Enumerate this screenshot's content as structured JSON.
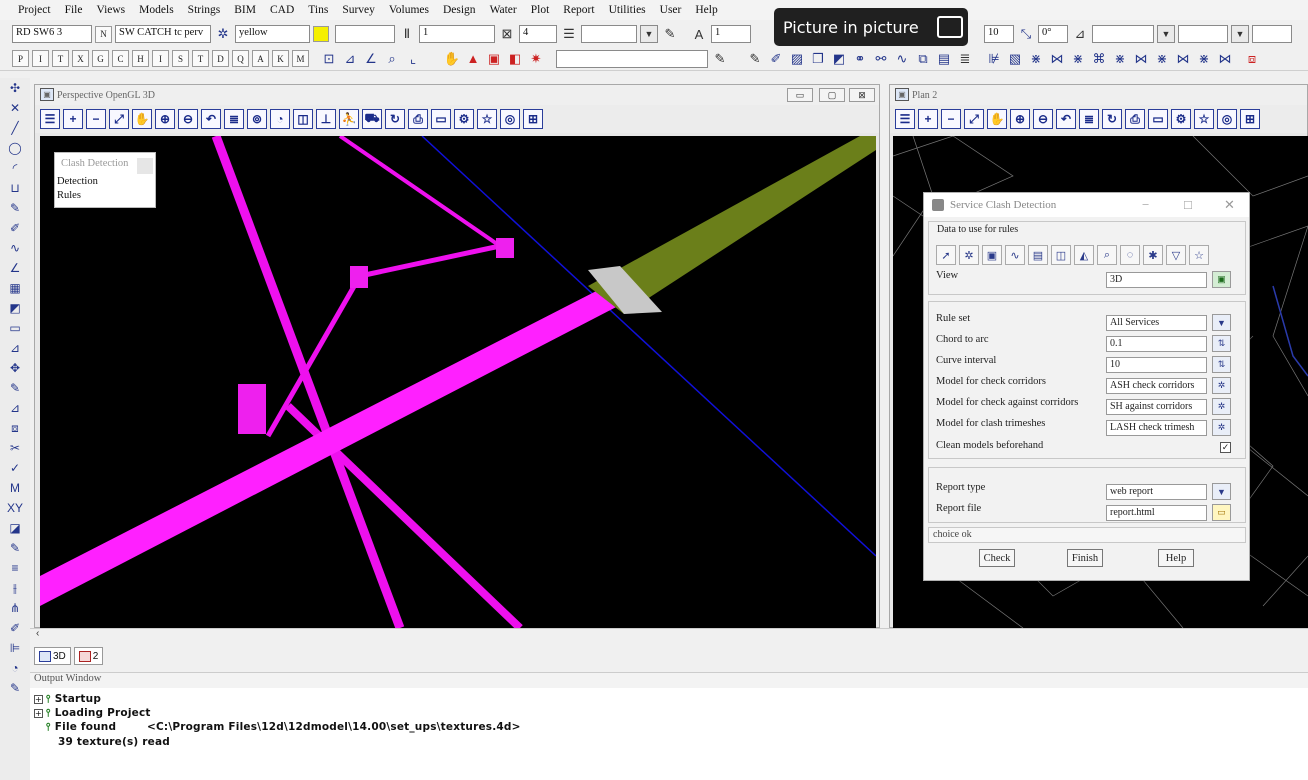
{
  "menu": [
    "Project",
    "File",
    "Views",
    "Models",
    "Strings",
    "BIM",
    "CAD",
    "Tins",
    "Survey",
    "Volumes",
    "Design",
    "Water",
    "Plot",
    "Report",
    "Utilities",
    "User",
    "Help"
  ],
  "toolbar1": {
    "string_field": "RD SW6 3",
    "n_button": "N",
    "name_field": "SW CATCH tc perv",
    "colour_field": "yellow",
    "colour_swatch": "#f5f000",
    "weight_field": "1",
    "style_field": "4",
    "height_field": "1",
    "size_field": "10",
    "angle_field": "0°"
  },
  "toolbar2": {
    "letters": [
      "P",
      "I",
      "T",
      "X",
      "G",
      "C",
      "H",
      "I",
      "S",
      "T",
      "D",
      "Q",
      "A",
      "K",
      "M"
    ]
  },
  "pip": {
    "label": "Picture in picture"
  },
  "left_window": {
    "title": "Perspective OpenGL 3D",
    "clash_panel": {
      "title": "Clash Detection",
      "items": [
        "Detection",
        "Rules"
      ]
    }
  },
  "right_window": {
    "title": "Plan 2"
  },
  "dialog": {
    "title": "Service Clash Detection",
    "group_label": "Data to use for rules",
    "view_label": "View",
    "view_value": "3D",
    "rule_set_label": "Rule set",
    "rule_set_value": "All Services",
    "chord_label": "Chord to arc",
    "chord_value": "0.1",
    "curve_label": "Curve interval",
    "curve_value": "10",
    "model_check_label": "Model for check corridors",
    "model_check_value": "ASH check corridors",
    "model_against_label": "Model for check against corridors",
    "model_against_value": "SH against corridors",
    "model_clash_label": "Model for clash trimeshes",
    "model_clash_value": "LASH check trimesh",
    "clean_label": "Clean models beforehand",
    "clean_checked": "✓",
    "report_type_label": "Report type",
    "report_type_value": "web report",
    "report_file_label": "Report file",
    "report_file_value": "report.html",
    "status": "choice ok",
    "check_btn": "Check",
    "finish_btn": "Finish",
    "help_btn": "Help"
  },
  "tabs": [
    {
      "label": "3D"
    },
    {
      "label": "2"
    }
  ],
  "output": {
    "title": "Output Window",
    "rows": [
      {
        "expand": "+",
        "text": "Startup"
      },
      {
        "expand": "+",
        "text": "Loading Project"
      },
      {
        "expand": "",
        "text": "File found        <C:\\Program Files\\12d\\12dmodel\\14.00\\set_ups\\textures.4d>"
      },
      {
        "expand": "",
        "text": "39 texture(s) read"
      }
    ]
  }
}
